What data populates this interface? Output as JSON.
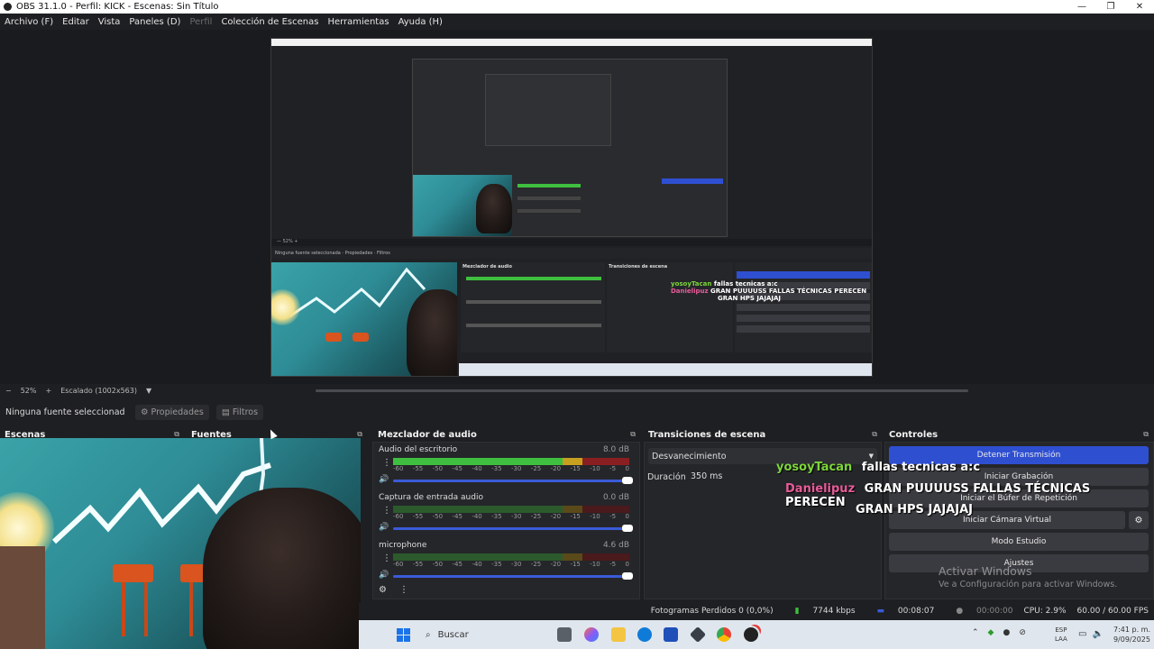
{
  "window": {
    "title": "OBS 31.1.0 - Perfil: KICK - Escenas: Sin Título",
    "minimize": "—",
    "maximize": "❐",
    "close": "✕"
  },
  "menu": [
    "Archivo (F)",
    "Editar",
    "Vista",
    "Paneles (D)",
    "Perfil",
    "Colección de Escenas",
    "Herramientas",
    "Ayuda (H)"
  ],
  "preview": {
    "zoom": "52%",
    "scaling": "Escalado (1002x563)",
    "inner_chat": {
      "user1": "yosoyTacan",
      "msg1": "fallas tecnicas a:c",
      "user2": "Danielipuz",
      "msg2": "GRAN PUUUUSS FALLAS TÉCNICAS PERECEN",
      "msg3": "GRAN HPS JAJAJAJ"
    }
  },
  "source_toolbar": {
    "no_source": "Ninguna fuente seleccionad",
    "properties": "Propiedades",
    "filters": "Filtros"
  },
  "docks": {
    "scenes": "Escenas",
    "sources": "Fuentes",
    "mixer": "Mezclador de audio",
    "transitions": "Transiciones de escena",
    "controls": "Controles"
  },
  "mixer": {
    "ticks": [
      "-60",
      "-55",
      "-50",
      "-45",
      "-40",
      "-35",
      "-30",
      "-25",
      "-20",
      "-15",
      "-10",
      "-5",
      "0"
    ],
    "channels": [
      {
        "name": "Audio del escritorio",
        "db": "8.0 dB",
        "level": 0.72
      },
      {
        "name": "Captura de entrada audio",
        "db": "0.0 dB",
        "level": 0.0
      },
      {
        "name": "microphone",
        "db": "4.6 dB",
        "level": 0.0
      }
    ]
  },
  "transitions": {
    "selected": "Desvanecimiento",
    "duration_label": "Duración",
    "duration_value": "350 ms"
  },
  "controls": {
    "stop_stream": "Detener Transmisión",
    "start_recording": "Iniciar Grabación",
    "replay_buffer": "Iniciar el Búfer de Repetición",
    "virtual_cam": "Iniciar Cámara Virtual",
    "studio_mode": "Modo Estudio",
    "settings": "Ajustes"
  },
  "chat": {
    "user1": "yosoyTacan",
    "msg1": "fallas tecnicas a:c",
    "user2": "Danielipuz",
    "msg2": "GRAN PUUUUSS FALLAS TÉCNICAS PERECEN",
    "msg3": "GRAN HPS JAJAJAJ",
    "user1_color": "#7cd63a",
    "user2_color": "#e85c9a"
  },
  "activation": {
    "title": "Activar Windows",
    "subtitle": "Ve a Configuración para activar Windows."
  },
  "status": {
    "dropped_frames": "Fotogramas Perdidos 0 (0,0%)",
    "bitrate": "7744 kbps",
    "stream_time": "00:08:07",
    "rec_time": "00:00:00",
    "cpu": "CPU: 2.9%",
    "fps": "60.00 / 60.00 FPS"
  },
  "taskbar": {
    "search": "Buscar",
    "lang1": "ESP",
    "lang2": "LAA",
    "time": "7:41 p. m.",
    "date": "9/09/2025"
  },
  "colors": {
    "accent": "#2f4fd1",
    "meter_green": "#3fbf3f",
    "meter_yellow": "#c8a020",
    "meter_red": "#8a1f22"
  }
}
